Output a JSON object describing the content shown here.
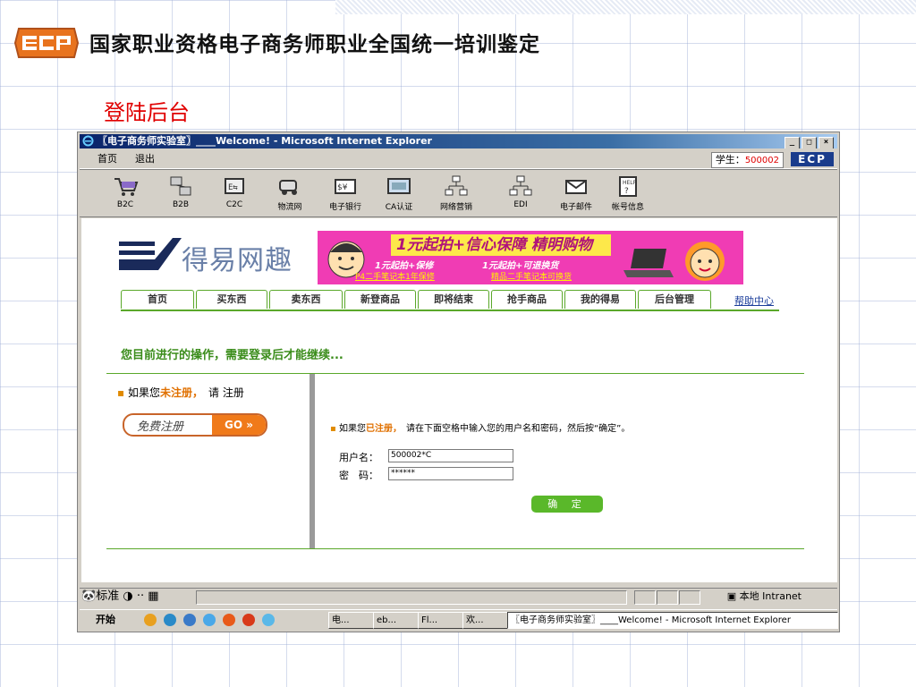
{
  "slide": {
    "title": "国家职业资格电子商务师职业全国统一培训鉴定",
    "section_title": "登陆后台"
  },
  "window": {
    "title": "〖电子商务师实验室〗____Welcome! - Microsoft Internet Explorer",
    "menu": [
      "首页",
      "退出"
    ],
    "student_label": "学生：",
    "student_id": "500002",
    "ecp_badge": "ECP"
  },
  "toolbar": {
    "items": [
      {
        "label": "B2C",
        "icon": "shopping-cart-icon"
      },
      {
        "label": "B2B",
        "icon": "network-icon"
      },
      {
        "label": "C2C",
        "icon": "exchange-icon"
      },
      {
        "label": "物流网",
        "icon": "truck-icon"
      },
      {
        "label": "电子银行",
        "icon": "money-icon"
      },
      {
        "label": "CA认证",
        "icon": "certificate-icon"
      },
      {
        "label": "网络营销",
        "icon": "hierarchy-icon"
      },
      {
        "label": "EDI",
        "icon": "edi-icon"
      },
      {
        "label": "电子邮件",
        "icon": "mail-icon"
      },
      {
        "label": "帐号信息",
        "icon": "help-icon"
      }
    ]
  },
  "site": {
    "brand": "得易网趣",
    "banner": {
      "headline": "1元起拍+信心保障 精明购物",
      "line1a": "1元起拍+保修",
      "line1b": "1元起拍+可退换货",
      "link1": "P4二手笔记本1年保修",
      "link2": "精品二手笔记本可换货"
    },
    "tabs": [
      "首页",
      "买东西",
      "卖东西",
      "新登商品",
      "即将结束",
      "抢手商品",
      "我的得易",
      "后台管理"
    ],
    "help_link": "帮助中心",
    "notice": "您目前进行的操作，需要登录后才能继续..."
  },
  "login": {
    "left_prefix": "如果您",
    "left_em": "未注册，",
    "left_suffix": "请 注册",
    "register_button": "免费注册",
    "go_label": "GO",
    "right_prefix": "如果您",
    "right_em": "已注册，",
    "right_suffix": "请在下面空格中输入您的用户名和密码，然后按“确定”。",
    "username_label": "用户名：",
    "username_value": "500002*C",
    "password_label": "密　码：",
    "password_value": "******",
    "ok_button": "确 定"
  },
  "statusbar": {
    "text": "标准",
    "zone": "本地 Intranet"
  },
  "taskbar": {
    "start": "开始",
    "items": [
      "电...",
      "eb...",
      "Fl...",
      "欢...",
      "〖电子商务师实验室〗____Welcome! - Microsoft Internet Explorer"
    ]
  },
  "colors": {
    "accent_green": "#5aa82a",
    "accent_red": "#e00000",
    "banner_pink": "#f03cb4"
  }
}
